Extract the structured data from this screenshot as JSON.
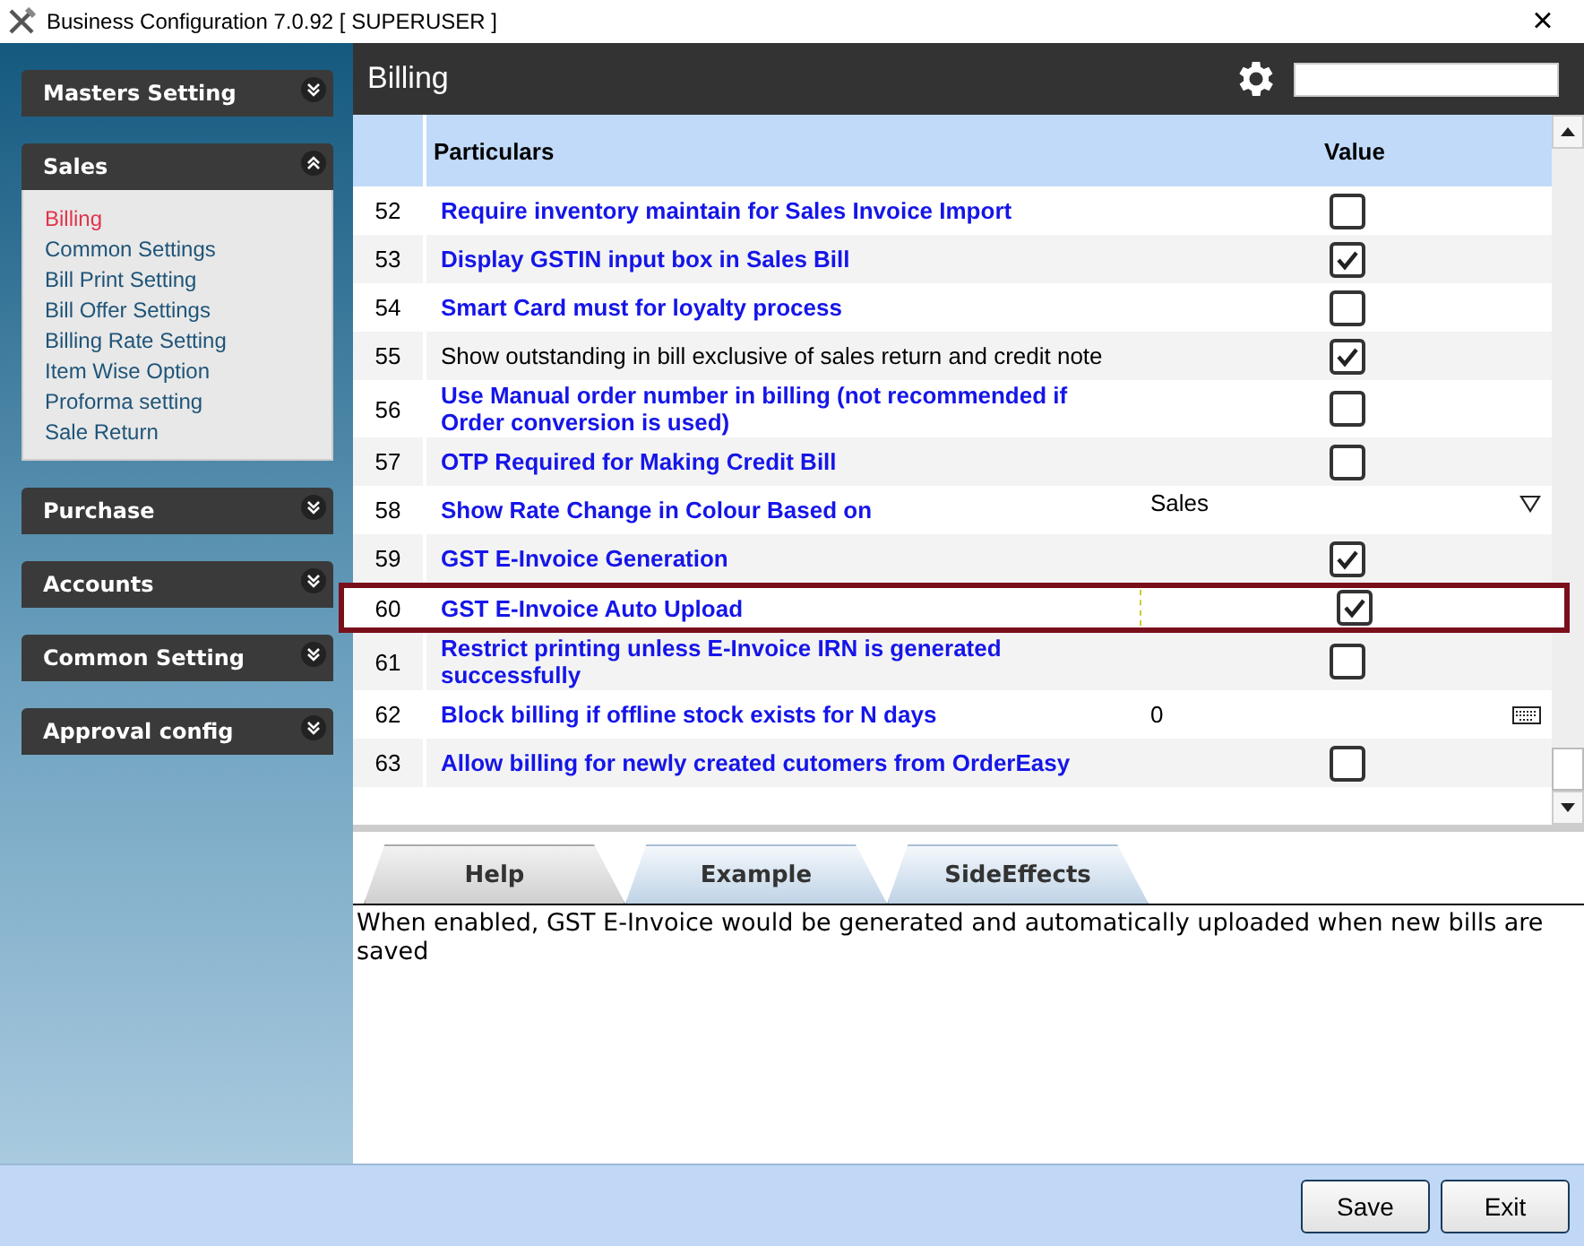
{
  "window": {
    "title": "Business Configuration 7.0.92 [ SUPERUSER ]",
    "close": "×"
  },
  "sidebar": {
    "sections": [
      {
        "title": "Masters Setting",
        "expanded": false
      },
      {
        "title": "Sales",
        "expanded": true,
        "items": [
          {
            "label": "Billing",
            "selected": true
          },
          {
            "label": "Common Settings",
            "selected": false
          },
          {
            "label": "Bill Print Setting",
            "selected": false
          },
          {
            "label": "Bill Offer Settings",
            "selected": false
          },
          {
            "label": "Billing Rate Setting",
            "selected": false
          },
          {
            "label": "Item Wise Option",
            "selected": false
          },
          {
            "label": "Proforma setting",
            "selected": false
          },
          {
            "label": "Sale Return",
            "selected": false
          }
        ]
      },
      {
        "title": "Purchase",
        "expanded": false
      },
      {
        "title": "Accounts",
        "expanded": false
      },
      {
        "title": "Common Setting",
        "expanded": false
      },
      {
        "title": "Approval config",
        "expanded": false
      }
    ]
  },
  "page": {
    "title": "Billing"
  },
  "table": {
    "columns": [
      "Particulars",
      "Value"
    ],
    "rows": [
      {
        "number": "52",
        "particular": "Require inventory maintain for Sales Invoice Import",
        "bold": true,
        "kind": "checkbox",
        "checked": false,
        "selected": false
      },
      {
        "number": "53",
        "particular": "Display GSTIN input box in Sales Bill",
        "bold": true,
        "kind": "checkbox",
        "checked": true,
        "selected": false
      },
      {
        "number": "54",
        "particular": "Smart Card must for loyalty process",
        "bold": true,
        "kind": "checkbox",
        "checked": false,
        "selected": false
      },
      {
        "number": "55",
        "particular": "Show outstanding in bill exclusive of sales return and credit note",
        "bold": false,
        "kind": "checkbox",
        "checked": true,
        "selected": false
      },
      {
        "number": "56",
        "particular": "Use Manual order number in billing (not recommended if Order conversion is used)",
        "bold": true,
        "kind": "checkbox",
        "checked": false,
        "selected": false
      },
      {
        "number": "57",
        "particular": "OTP Required for Making Credit Bill",
        "bold": true,
        "kind": "checkbox",
        "checked": false,
        "selected": false
      },
      {
        "number": "58",
        "particular": "Show Rate Change in Colour Based on",
        "bold": true,
        "kind": "dropdown",
        "value": "Sales",
        "selected": false
      },
      {
        "number": "59",
        "particular": "GST E-Invoice Generation",
        "bold": true,
        "kind": "checkbox",
        "checked": true,
        "selected": false
      },
      {
        "number": "60",
        "particular": "GST E-Invoice Auto Upload",
        "bold": true,
        "kind": "checkbox",
        "checked": true,
        "selected": true
      },
      {
        "number": "61",
        "particular": "Restrict printing unless E-Invoice IRN is generated successfully",
        "bold": true,
        "kind": "checkbox",
        "checked": false,
        "selected": false
      },
      {
        "number": "62",
        "particular": "Block billing if offline stock exists for N days",
        "bold": true,
        "kind": "number",
        "value": "0",
        "selected": false
      },
      {
        "number": "63",
        "particular": "Allow billing for newly created cutomers from OrderEasy",
        "bold": true,
        "kind": "checkbox",
        "checked": false,
        "selected": false
      }
    ]
  },
  "tabs": [
    {
      "label": "Help",
      "selected": true
    },
    {
      "label": "Example",
      "selected": false
    },
    {
      "label": "SideEffects",
      "selected": false
    }
  ],
  "help_text": "When enabled, GST E-Invoice would be generated and automatically uploaded when new bills are saved",
  "buttons": [
    "Save",
    "Exit"
  ]
}
